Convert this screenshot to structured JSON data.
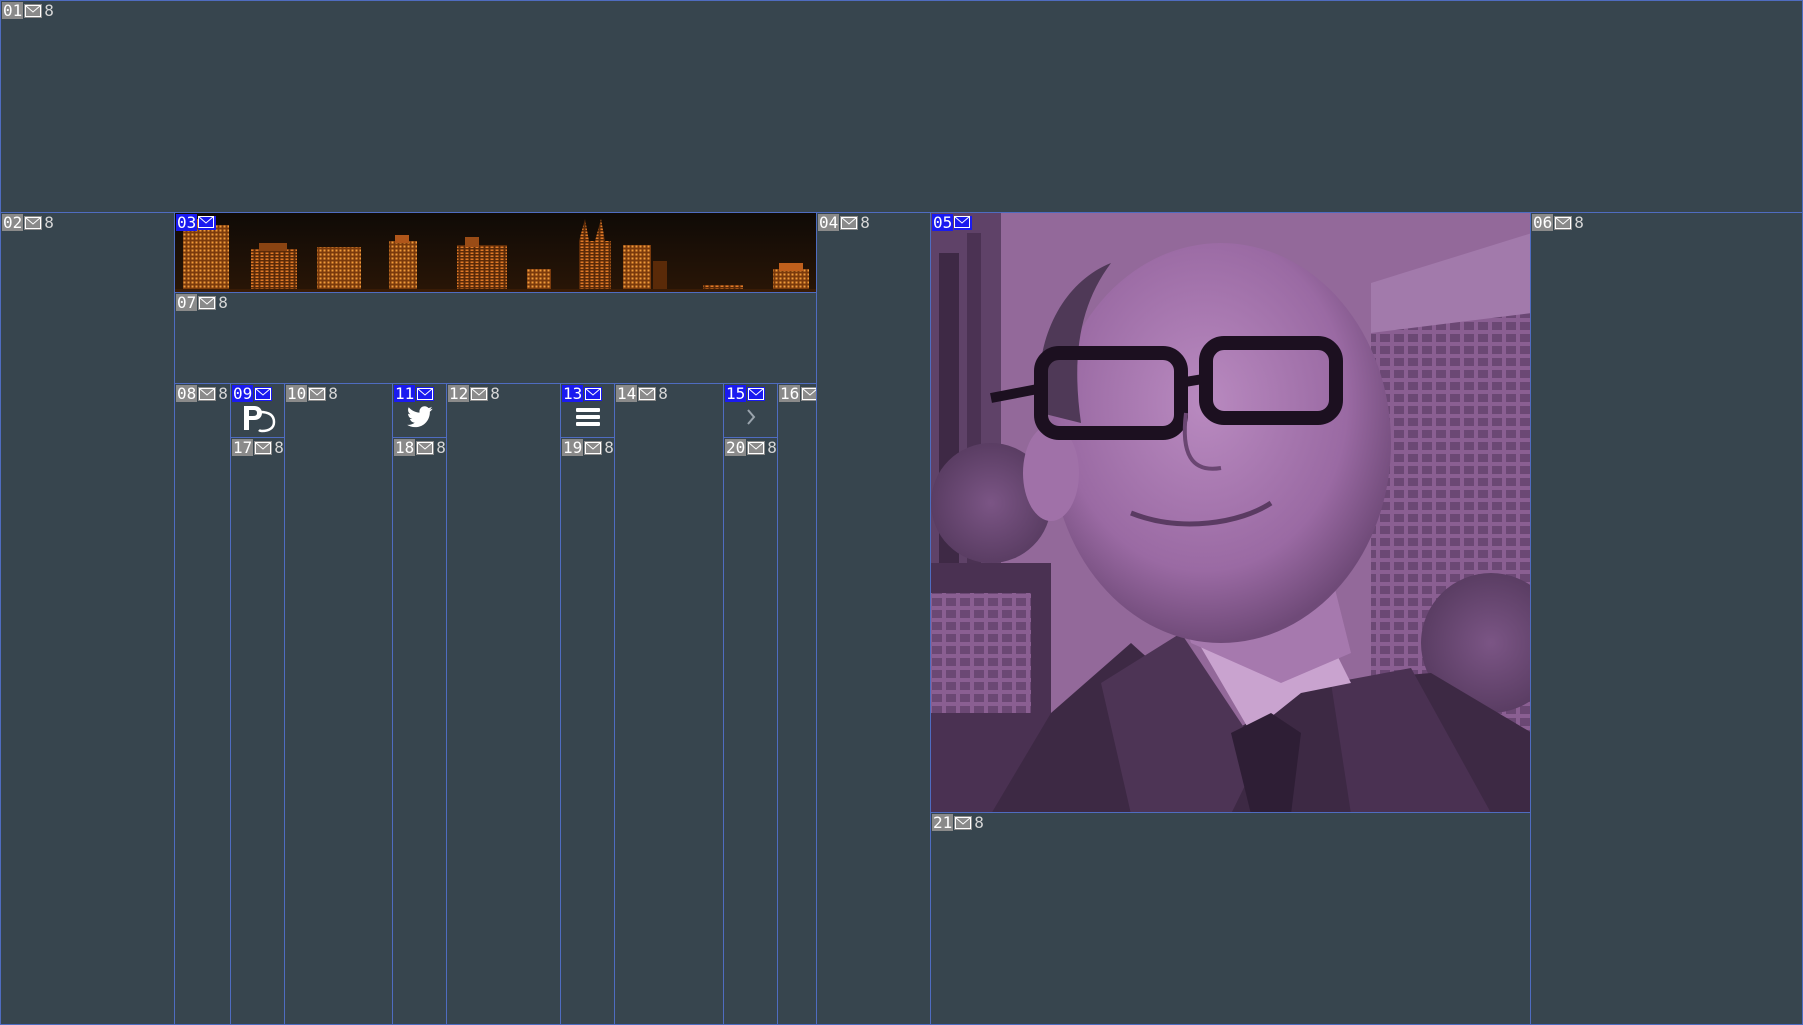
{
  "colors": {
    "background": "#37454e",
    "outline": "#4f6cc0",
    "tag_grey": "#8a8a8a",
    "tag_selected": "#1a1af0",
    "skyline_orange": "#e07a28",
    "portrait_tint": "#9a6aa0"
  },
  "cells": {
    "c01": {
      "num": "01",
      "count": "8"
    },
    "c02": {
      "num": "02",
      "count": "8"
    },
    "c03": {
      "num": "03",
      "count": ""
    },
    "c04": {
      "num": "04",
      "count": "8"
    },
    "c05": {
      "num": "05",
      "count": ""
    },
    "c06": {
      "num": "06",
      "count": "8"
    },
    "c07": {
      "num": "07",
      "count": "8"
    },
    "c08": {
      "num": "08",
      "count": "8"
    },
    "c09": {
      "num": "09",
      "count": ""
    },
    "c10": {
      "num": "10",
      "count": "8"
    },
    "c11": {
      "num": "11",
      "count": ""
    },
    "c12": {
      "num": "12",
      "count": "8"
    },
    "c13": {
      "num": "13",
      "count": ""
    },
    "c14": {
      "num": "14",
      "count": "8"
    },
    "c15": {
      "num": "15",
      "count": ""
    },
    "c16": {
      "num": "16",
      "count": ""
    },
    "c17": {
      "num": "17",
      "count": "8"
    },
    "c18": {
      "num": "18",
      "count": "8"
    },
    "c19": {
      "num": "19",
      "count": "8"
    },
    "c20": {
      "num": "20",
      "count": "8"
    },
    "c21": {
      "num": "21",
      "count": "8"
    }
  },
  "icons": {
    "c09": "publication-logo-icon",
    "c11": "twitter-bird-icon",
    "c13": "hamburger-menu-icon",
    "c15": "chevron-right-icon"
  },
  "images": {
    "c03": "city-skyline-banner",
    "c05": "portrait-photo"
  }
}
